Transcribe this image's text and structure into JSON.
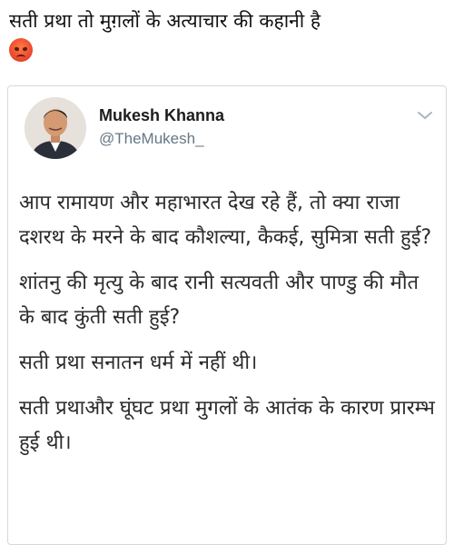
{
  "post": {
    "caption": "सती प्रथा तो मुग़लों के अत्याचार की कहानी है",
    "reaction_icon": "angry-face-emoji"
  },
  "tweet": {
    "author": {
      "name": "Mukesh Khanna",
      "handle": "@TheMukesh_"
    },
    "paragraphs": [
      "आप रामायण और महाभारत देख रहे हैं, तो क्या राजा दशरथ के मरने के बाद कौशल्या, कैकई, सुमित्रा सती हुई?",
      "शांतनु की मृत्यु के बाद रानी सत्यवती और पाण्डु की मौत के बाद कुंती सती हुई?",
      "सती प्रथा सनातन धर्म में नहीं थी।",
      "सती प्रथाऔर घूंघट प्रथा मुगलों के आतंक के कारण प्रारम्भ हुई थी।"
    ]
  }
}
